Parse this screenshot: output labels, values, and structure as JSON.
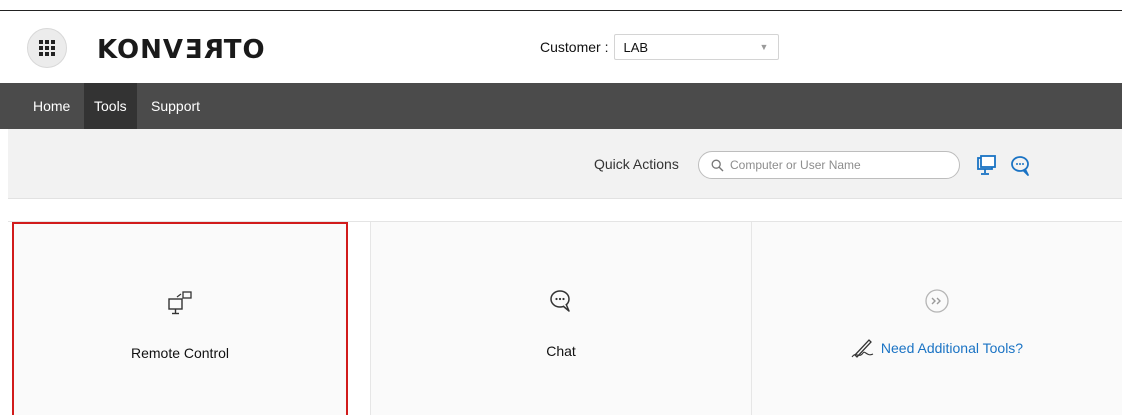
{
  "header": {
    "logo_text": "KONVERTO",
    "customer_label": "Customer :",
    "customer_value": "LAB"
  },
  "nav": {
    "items": [
      {
        "label": "Home"
      },
      {
        "label": "Tools"
      },
      {
        "label": "Support"
      }
    ],
    "active": "Tools"
  },
  "quick_actions": {
    "label": "Quick Actions",
    "search_placeholder": "Computer or User Name"
  },
  "cards": [
    {
      "label": "Remote Control",
      "icon": "remote-control-icon",
      "selected": true
    },
    {
      "label": "Chat",
      "icon": "chat-icon",
      "selected": false
    },
    {
      "label": "Need Additional Tools?",
      "icon": "more-tools-icon",
      "link": true
    }
  ],
  "colors": {
    "nav_bg": "#4b4b4b",
    "nav_active_bg": "#333333",
    "link": "#1a73c4",
    "icon_blue": "#1a73c4",
    "selected_border": "#d11b1b"
  }
}
